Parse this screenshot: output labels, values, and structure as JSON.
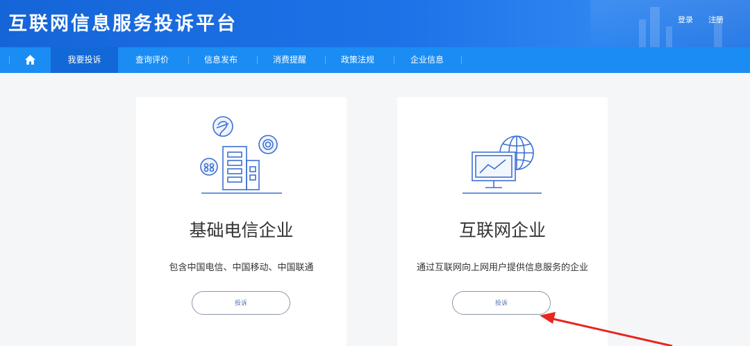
{
  "header": {
    "site_title": "互联网信息服务投诉平台",
    "login_label": "登录",
    "register_label": "注册"
  },
  "nav": {
    "home_icon": "home-icon",
    "items": [
      {
        "label": "我要投诉",
        "active": true
      },
      {
        "label": "查询评价",
        "active": false
      },
      {
        "label": "信息发布",
        "active": false
      },
      {
        "label": "消费提醒",
        "active": false
      },
      {
        "label": "政策法规",
        "active": false
      },
      {
        "label": "企业信息",
        "active": false
      }
    ]
  },
  "cards": [
    {
      "icon": "telecom-building-icon",
      "title": "基础电信企业",
      "description": "包含中国电信、中国移动、中国联通",
      "button_label": "投诉"
    },
    {
      "icon": "internet-monitor-globe-icon",
      "title": "互联网企业",
      "description": "通过互联网向上网用户提供信息服务的企业",
      "button_label": "投诉"
    }
  ],
  "colors": {
    "header_blue": "#1565d8",
    "nav_blue": "#1a8cf3",
    "nav_active": "#1268d6",
    "icon_blue": "#3b6fd4",
    "arrow_red": "#e8261f"
  }
}
